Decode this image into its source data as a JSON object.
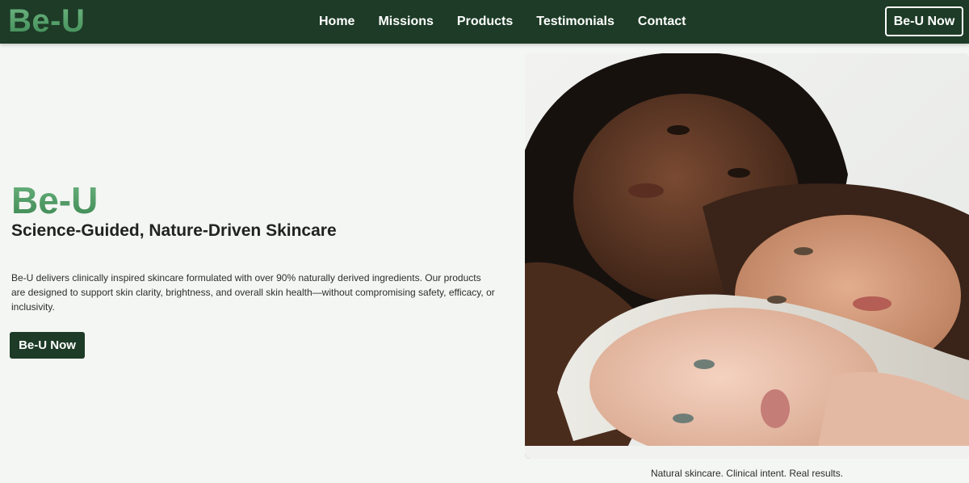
{
  "navbar": {
    "logo": "Be-U",
    "links": [
      {
        "label": "Home"
      },
      {
        "label": "Missions"
      },
      {
        "label": "Products"
      },
      {
        "label": "Testimonials"
      },
      {
        "label": "Contact"
      }
    ],
    "cta_label": "Be-U Now"
  },
  "hero": {
    "title": "Be-U",
    "subtitle": "Science-Guided, Nature-Driven Skincare",
    "description": "Be-U delivers clinically inspired skincare formulated with over 90% naturally derived ingredients. Our products are designed to support skin clarity, brightness, and overall skin health—without compromising safety, efficacy, or inclusivity.",
    "cta_label": "Be-U Now",
    "caption": "Natural skincare. Clinical intent. Real results."
  },
  "colors": {
    "nav_bg": "#1d3b26",
    "accent_green": "#4f9a65",
    "page_bg": "#f4f6f3"
  }
}
